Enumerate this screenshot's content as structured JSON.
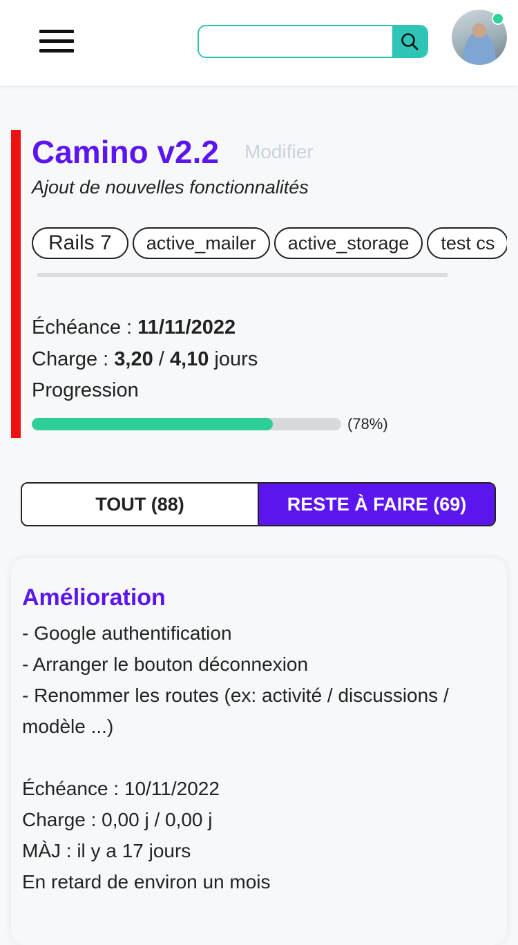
{
  "header": {
    "search_placeholder": "",
    "search_value": ""
  },
  "project": {
    "title": "Camino v2.2",
    "edit_label": "Modifier",
    "subtitle": "Ajout de nouvelles fonctionnalités",
    "tags": [
      "Rails 7",
      "active_mailer",
      "active_storage",
      "test cs"
    ],
    "deadline_label": "Échéance : ",
    "deadline_value": "11/11/2022",
    "load_label": "Charge : ",
    "load_done": "3,20",
    "load_sep": " / ",
    "load_total": "4,10",
    "load_unit": " jours",
    "progress_label": "Progression",
    "progress_value": 0.78,
    "progress_text": "(78%)"
  },
  "filters": {
    "all_label": "TOUT (88)",
    "todo_label": "RESTE À FAIRE (69)",
    "active": "todo"
  },
  "card": {
    "title": "Amélioration",
    "lines": [
      "- Google authentification",
      "- Arranger le bouton déconnexion",
      "- Renommer les routes (ex: activité / discussions /",
      "modèle ...)"
    ],
    "deadline": "Échéance : 10/11/2022",
    "load": "Charge : 0,00 j / 0,00 j",
    "updated": "MÀJ : il y a 17 jours",
    "delay": "En retard de environ un mois"
  },
  "colors": {
    "accent": "#5b16f0",
    "teal": "#2ec4b6",
    "progress": "#2ecf96",
    "danger": "#ee1111"
  }
}
